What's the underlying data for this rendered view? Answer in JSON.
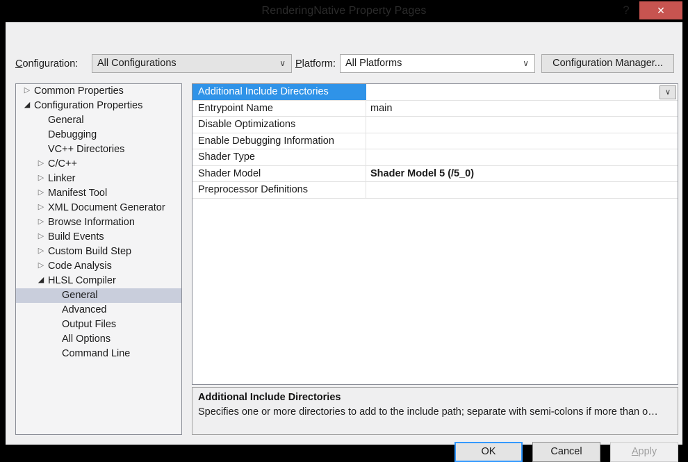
{
  "window": {
    "title": "RenderingNative Property Pages",
    "help_icon_label": "?",
    "close_icon_label": "✕",
    "close_button_color": "#c75450",
    "accent_color": "#2f93e8",
    "tree_selection_color": "#c9cedc"
  },
  "toolbar": {
    "configuration_label": "Configuration:",
    "configuration_value": "All Configurations",
    "platform_label": "Platform:",
    "platform_value": "All Platforms",
    "configuration_manager_label": "Configuration Manager...",
    "dropdown_arrow": "∨"
  },
  "tree": {
    "items": [
      {
        "label": "Common Properties",
        "indent": 0,
        "state": "collapsed",
        "selected": false
      },
      {
        "label": "Configuration Properties",
        "indent": 0,
        "state": "expanded",
        "selected": false
      },
      {
        "label": "General",
        "indent": 1,
        "state": "leaf",
        "selected": false
      },
      {
        "label": "Debugging",
        "indent": 1,
        "state": "leaf",
        "selected": false
      },
      {
        "label": "VC++ Directories",
        "indent": 1,
        "state": "leaf",
        "selected": false
      },
      {
        "label": "C/C++",
        "indent": 1,
        "state": "collapsed",
        "selected": false
      },
      {
        "label": "Linker",
        "indent": 1,
        "state": "collapsed",
        "selected": false
      },
      {
        "label": "Manifest Tool",
        "indent": 1,
        "state": "collapsed",
        "selected": false
      },
      {
        "label": "XML Document Generator",
        "indent": 1,
        "state": "collapsed",
        "selected": false
      },
      {
        "label": "Browse Information",
        "indent": 1,
        "state": "collapsed",
        "selected": false
      },
      {
        "label": "Build Events",
        "indent": 1,
        "state": "collapsed",
        "selected": false
      },
      {
        "label": "Custom Build Step",
        "indent": 1,
        "state": "collapsed",
        "selected": false
      },
      {
        "label": "Code Analysis",
        "indent": 1,
        "state": "collapsed",
        "selected": false
      },
      {
        "label": "HLSL Compiler",
        "indent": 1,
        "state": "expanded",
        "selected": false
      },
      {
        "label": "General",
        "indent": 2,
        "state": "leaf",
        "selected": true
      },
      {
        "label": "Advanced",
        "indent": 2,
        "state": "leaf",
        "selected": false
      },
      {
        "label": "Output Files",
        "indent": 2,
        "state": "leaf",
        "selected": false
      },
      {
        "label": "All Options",
        "indent": 2,
        "state": "leaf",
        "selected": false
      },
      {
        "label": "Command Line",
        "indent": 2,
        "state": "leaf",
        "selected": false
      }
    ]
  },
  "grid": {
    "dropdown_arrow": "∨",
    "rows": [
      {
        "name": "Additional Include Directories",
        "value": "",
        "selected": true,
        "bold": false
      },
      {
        "name": "Entrypoint Name",
        "value": "main",
        "selected": false,
        "bold": false
      },
      {
        "name": "Disable Optimizations",
        "value": "",
        "selected": false,
        "bold": false
      },
      {
        "name": "Enable Debugging Information",
        "value": "",
        "selected": false,
        "bold": false
      },
      {
        "name": "Shader Type",
        "value": "",
        "selected": false,
        "bold": false
      },
      {
        "name": "Shader Model",
        "value": "Shader Model 5 (/5_0)",
        "selected": false,
        "bold": true
      },
      {
        "name": "Preprocessor Definitions",
        "value": "",
        "selected": false,
        "bold": false
      }
    ]
  },
  "description": {
    "title": "Additional Include Directories",
    "text": "Specifies one or more directories to add to the include path; separate with semi-colons if more than o…"
  },
  "buttons": {
    "ok": "OK",
    "cancel": "Cancel",
    "apply": "Apply"
  }
}
